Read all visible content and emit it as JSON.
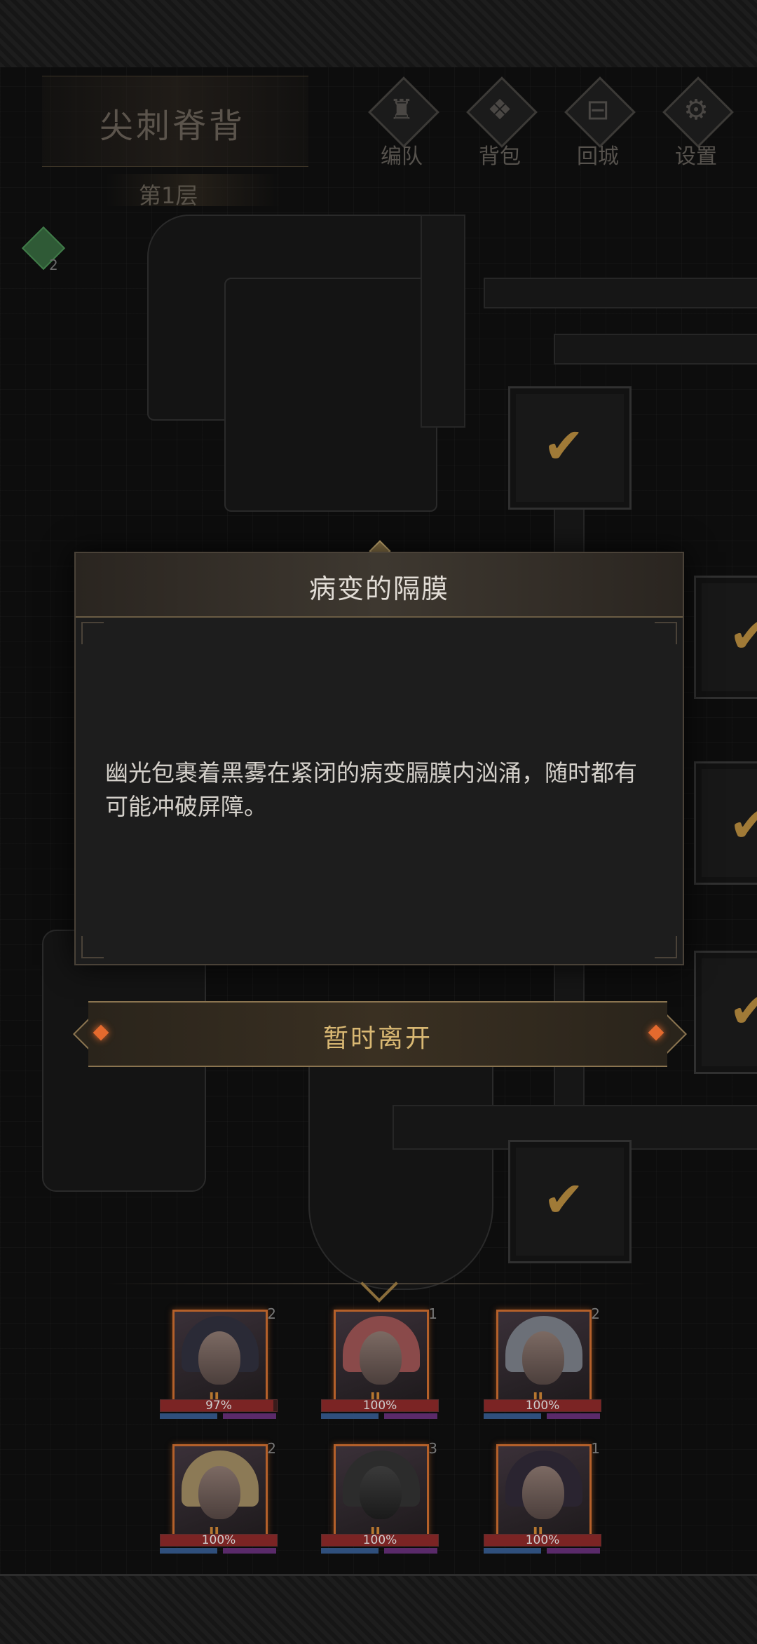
{
  "header": {
    "location_name": "尖刺脊背",
    "floor_label": "第1层",
    "buttons": [
      {
        "label": "编队",
        "icon": "helmet-icon"
      },
      {
        "label": "背包",
        "icon": "bag-icon"
      },
      {
        "label": "回城",
        "icon": "gate-icon"
      },
      {
        "label": "设置",
        "icon": "gear-icon"
      }
    ],
    "buff_count": "2"
  },
  "dialog": {
    "title": "病变的隔膜",
    "body": "幽光包裹着黑雾在紧闭的病变膈膜内汹涌，随时都有可能冲破屏障。",
    "leave_button": "暂时离开"
  },
  "party": {
    "heroes": [
      {
        "stars": "2",
        "rank": "II",
        "hp_percent": "97%",
        "hp_fraction": 0.97
      },
      {
        "stars": "1",
        "rank": "II",
        "hp_percent": "100%",
        "hp_fraction": 1.0
      },
      {
        "stars": "2",
        "rank": "II",
        "hp_percent": "100%",
        "hp_fraction": 1.0
      },
      {
        "stars": "2",
        "rank": "II",
        "hp_percent": "100%",
        "hp_fraction": 1.0
      },
      {
        "stars": "3",
        "rank": "II",
        "hp_percent": "100%",
        "hp_fraction": 1.0
      },
      {
        "stars": "1",
        "rank": "II",
        "hp_percent": "100%",
        "hp_fraction": 1.0
      }
    ]
  },
  "colors": {
    "accent_gold": "#d9b873",
    "check_gold": "#a07a37",
    "portrait_border": "#b4602a",
    "hp_red": "#7b2424"
  }
}
